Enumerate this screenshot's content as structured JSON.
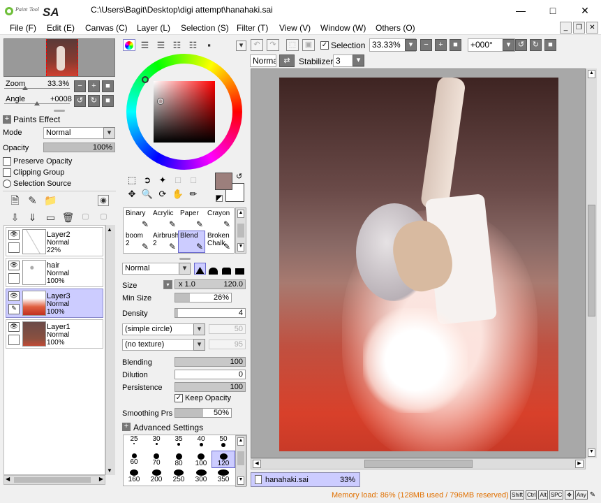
{
  "app": {
    "title": "C:\\Users\\Bagit\\Desktop\\digi attempt\\hanahaki.sai",
    "logo_text": "PaintTool SAI",
    "window_controls": [
      "minimize-icon",
      "maximize-icon",
      "close-icon"
    ]
  },
  "menu": [
    "File (F)",
    "Edit (E)",
    "Canvas (C)",
    "Layer (L)",
    "Selection (S)",
    "Filter (T)",
    "View (V)",
    "Window (W)",
    "Others (O)"
  ],
  "navigator": {
    "zoom_label": "Zoom",
    "zoom_value": "33.3%",
    "angle_label": "Angle",
    "angle_value": "+0008"
  },
  "layer_panel": {
    "paints_effect": "Paints Effect",
    "mode_label": "Mode",
    "mode_value": "Normal",
    "opacity_label": "Opacity",
    "opacity_value": "100%",
    "opacity_fraction": 1.0,
    "preserve_opacity": "Preserve Opacity",
    "clipping_group": "Clipping Group",
    "selection_source": "Selection Source",
    "layers": [
      {
        "name": "Layer2",
        "mode": "Normal",
        "opacity": "22%",
        "selected": false,
        "thumb": "sketch"
      },
      {
        "name": "hair",
        "mode": "Normal",
        "opacity": "100%",
        "selected": false,
        "thumb": "hair"
      },
      {
        "name": "Layer3",
        "mode": "Normal",
        "opacity": "100%",
        "selected": true,
        "thumb": "red"
      },
      {
        "name": "Layer1",
        "mode": "Normal",
        "opacity": "100%",
        "selected": false,
        "thumb": "dark"
      }
    ]
  },
  "tools": {
    "brushes": [
      {
        "label": "Binary",
        "sub": ""
      },
      {
        "label": "Acrylic",
        "sub": ""
      },
      {
        "label": "Paper",
        "sub": ""
      },
      {
        "label": "Crayon",
        "sub": ""
      },
      {
        "label": "boom",
        "sub": "2"
      },
      {
        "label": "Airbrush",
        "sub": "2"
      },
      {
        "label": "Blend",
        "sub": "",
        "selected": true
      },
      {
        "label": "Broken",
        "sub": "Chalk"
      }
    ],
    "blend_mode": "Normal",
    "size_label": "Size",
    "size_mult": "x 1.0",
    "size_value": "120.0",
    "min_size_label": "Min Size",
    "min_size_value": "26%",
    "min_size_fraction": 0.26,
    "density_label": "Density",
    "density_value": "4",
    "density_fraction": 0.04,
    "shape": "(simple circle)",
    "shape_value": "50",
    "texture": "(no texture)",
    "texture_value": "95",
    "blending_label": "Blending",
    "blending_value": "100",
    "dilution_label": "Dilution",
    "dilution_value": "0",
    "persistence_label": "Persistence",
    "persistence_value": "100",
    "keep_opacity": "Keep Opacity",
    "smoothing_label": "Smoothing Prs",
    "smoothing_value": "50%",
    "smoothing_fraction": 0.5,
    "advanced": "Advanced Settings",
    "brush_sizes_row1": [
      "25",
      "30",
      "35",
      "40",
      "50"
    ],
    "brush_sizes_row2": [
      "60",
      "70",
      "80",
      "100",
      "120"
    ],
    "brush_sizes_row3": [
      "160",
      "200",
      "250",
      "300",
      "350"
    ],
    "selected_size": "120"
  },
  "toolbar": {
    "selection_label": "Selection",
    "zoom": "33.33%",
    "rotation": "+000°",
    "mode": "Normal",
    "stabilizer_label": "Stabilizer",
    "stabilizer_value": "3"
  },
  "document_tab": {
    "name": "hanahaki.sai",
    "zoom": "33%"
  },
  "status": {
    "memory": "Memory load: 86% (128MB used / 796MB reserved)",
    "keys": [
      "Shift",
      "Ctrl",
      "Alt",
      "SPC",
      "Any"
    ]
  },
  "colors": {
    "current_color": "#9c7f7c",
    "selection_bg": "#ccccff",
    "memory_text": "#e07000"
  }
}
